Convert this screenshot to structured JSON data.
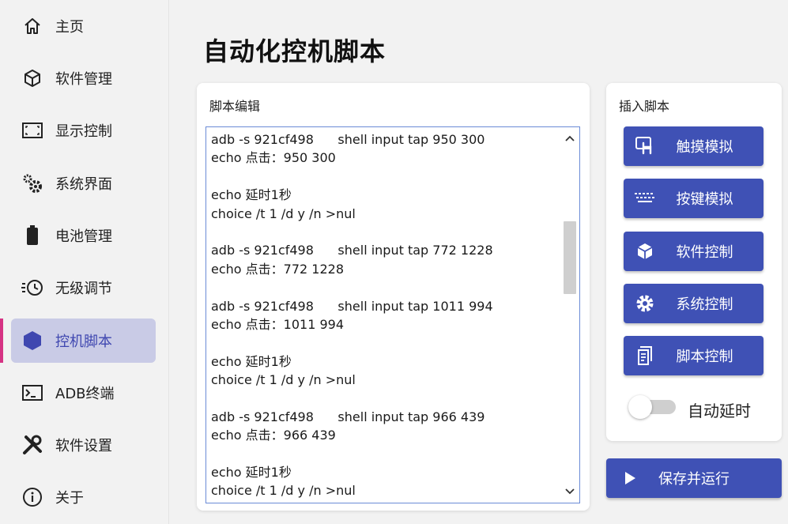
{
  "sidebar": {
    "items": [
      {
        "label": "主页",
        "icon": "home-icon"
      },
      {
        "label": "软件管理",
        "icon": "cube-icon"
      },
      {
        "label": "显示控制",
        "icon": "screen-corners-icon"
      },
      {
        "label": "系统界面",
        "icon": "gears-icon"
      },
      {
        "label": "电池管理",
        "icon": "battery-icon"
      },
      {
        "label": "无级调节",
        "icon": "clock-dial-icon"
      },
      {
        "label": "控机脚本",
        "icon": "hexagon-icon",
        "active": true
      },
      {
        "label": "ADB终端",
        "icon": "terminal-icon"
      },
      {
        "label": "软件设置",
        "icon": "tools-icon"
      },
      {
        "label": "关于",
        "icon": "info-icon"
      }
    ]
  },
  "page": {
    "title": "自动化控机脚本"
  },
  "editor": {
    "label": "脚本编辑",
    "lines": [
      "adb -s 921cf498      shell input tap 950 300",
      "echo 点击：950 300",
      "",
      "echo 延时1秒",
      "choice /t 1 /d y /n >nul",
      "",
      "adb -s 921cf498      shell input tap 772 1228",
      "echo 点击：772 1228",
      "",
      "adb -s 921cf498      shell input tap 1011 994",
      "echo 点击：1011 994",
      "",
      "echo 延时1秒",
      "choice /t 1 /d y /n >nul",
      "",
      "adb -s 921cf498      shell input tap 966 439",
      "echo 点击：966 439",
      "",
      "echo 延时1秒",
      "choice /t 1 /d y /n >nul"
    ]
  },
  "insert": {
    "label": "插入脚本",
    "buttons": [
      {
        "label": "触摸模拟",
        "icon": "touch-icon"
      },
      {
        "label": "按键模拟",
        "icon": "keyboard-icon"
      },
      {
        "label": "软件控制",
        "icon": "cube-icon"
      },
      {
        "label": "系统控制",
        "icon": "gear-icon"
      },
      {
        "label": "脚本控制",
        "icon": "script-icon"
      }
    ],
    "auto_delay_label": "自动延时",
    "auto_delay_on": false
  },
  "run": {
    "label": "保存并运行",
    "icon": "play-icon"
  },
  "colors": {
    "accent": "#3f51b5",
    "active_bg": "#c9cbe6",
    "active_bar": "#d63384"
  }
}
